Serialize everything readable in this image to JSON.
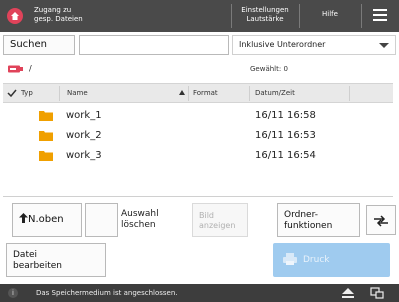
{
  "header": {
    "title_line1": "Zugang zu",
    "title_line2": "gesp. Dateien",
    "settings_line1": "Einstellungen",
    "settings_line2": "Lautstärke",
    "help": "Hilfe"
  },
  "search": {
    "button_label": "Suchen",
    "value": "",
    "placeholder": ""
  },
  "scope_select": {
    "selected": "Inklusive Unterordner"
  },
  "path": {
    "text": "/",
    "selected_count": "Gewählt: 0"
  },
  "table": {
    "columns": {
      "type": "Typ",
      "name": "Name",
      "format": "Format",
      "datetime": "Datum/Zeit"
    },
    "rows": [
      {
        "name": "work_1",
        "format": "",
        "datetime": "16/11  16:58"
      },
      {
        "name": "work_2",
        "format": "",
        "datetime": "16/11  16:53"
      },
      {
        "name": "work_3",
        "format": "",
        "datetime": "16/11  16:54"
      }
    ]
  },
  "actions": {
    "up_label": "N.oben",
    "deselect_line1": "Auswahl",
    "deselect_line2": "löschen",
    "show_image_line1": "Bild",
    "show_image_line2": "anzeigen",
    "folder_line1": "Ordner-",
    "folder_line2": "funktionen",
    "edit_line1": "Datei",
    "edit_line2": "bearbeiten",
    "print_label": "Druck"
  },
  "status": {
    "message": "Das Speichermedium ist angeschlossen."
  },
  "colors": {
    "brand": "#e0435a",
    "folder": "#f0a000",
    "print_disabled": "#9fcbef"
  }
}
